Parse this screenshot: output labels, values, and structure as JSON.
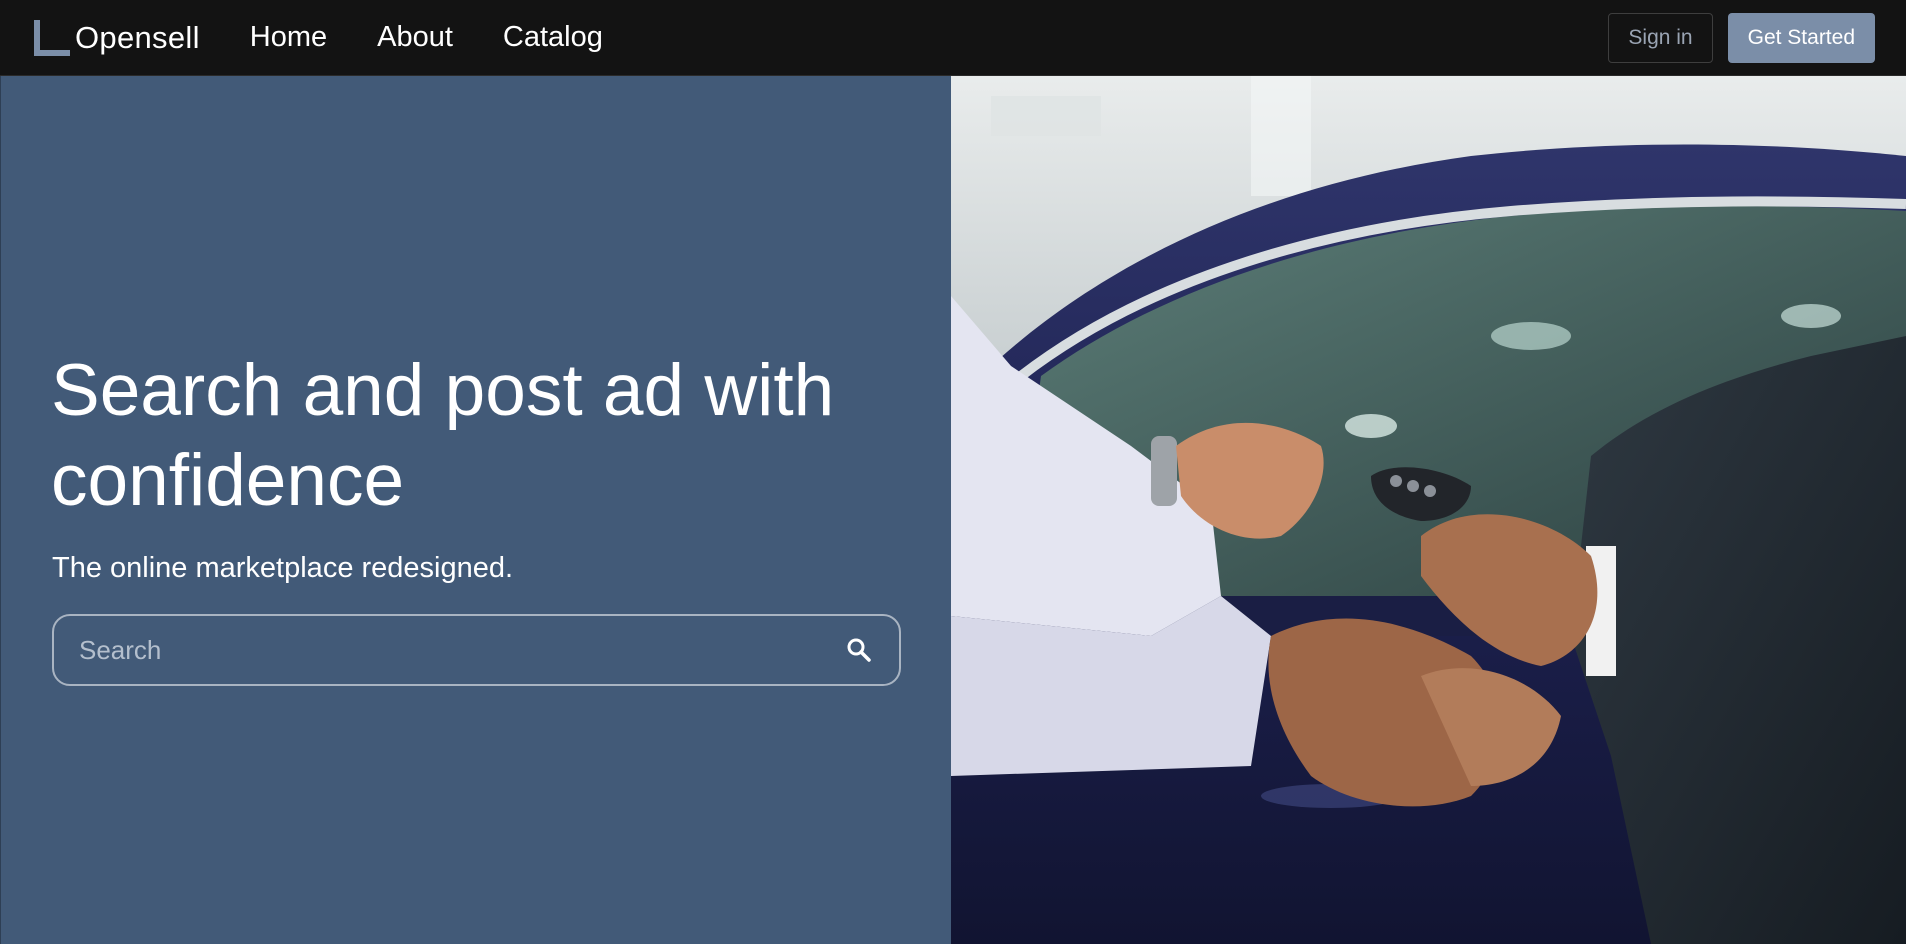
{
  "brand": {
    "name": "Opensell",
    "logo_icon": "logo-square-icon",
    "accent": "#7b8ea8"
  },
  "nav": {
    "items": [
      {
        "label": "Home"
      },
      {
        "label": "About"
      },
      {
        "label": "Catalog"
      }
    ],
    "sign_in_label": "Sign in",
    "get_started_label": "Get Started"
  },
  "hero": {
    "headline": "Search and post ad with confidence",
    "subtitle": "The online marketplace redesigned.",
    "search": {
      "placeholder": "Search",
      "value": "",
      "icon": "search-icon"
    },
    "image": {
      "alt": "Car dealer handing over car key and shaking hands with buyer"
    },
    "panel_color": "#425a78"
  }
}
